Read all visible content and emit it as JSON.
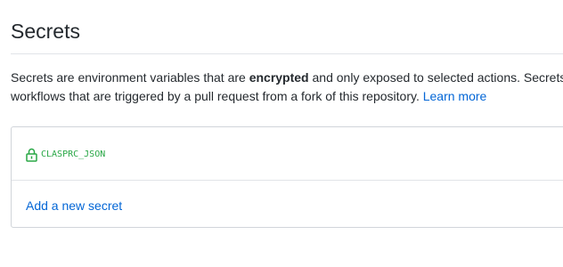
{
  "page": {
    "title": "Secrets"
  },
  "description": {
    "line1_before": "Secrets are environment variables that are ",
    "line1_bold": "encrypted",
    "line1_after": " and only exposed to selected actions. Secrets a",
    "line2_text": "workflows that are triggered by a pull request from a fork of this repository. ",
    "learn_more_label": "Learn more"
  },
  "secrets": {
    "items": [
      {
        "name": "CLASPRC_JSON",
        "icon": "lock-icon"
      }
    ],
    "add_label": "Add a new secret"
  },
  "colors": {
    "link": "#0366d6",
    "secret_name": "#28a745",
    "border": "#d1d5da",
    "text": "#24292e"
  }
}
